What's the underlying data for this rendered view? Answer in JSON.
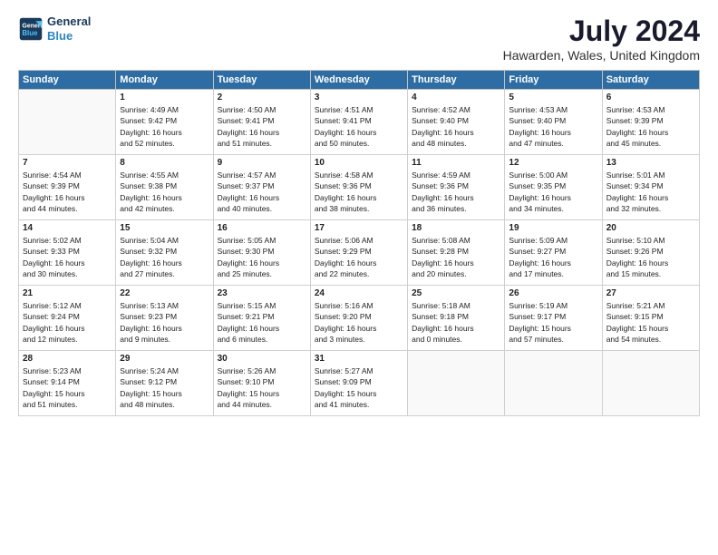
{
  "header": {
    "logo_line1": "General",
    "logo_line2": "Blue",
    "month": "July 2024",
    "location": "Hawarden, Wales, United Kingdom"
  },
  "weekdays": [
    "Sunday",
    "Monday",
    "Tuesday",
    "Wednesday",
    "Thursday",
    "Friday",
    "Saturday"
  ],
  "weeks": [
    [
      {
        "day": "",
        "info": ""
      },
      {
        "day": "1",
        "info": "Sunrise: 4:49 AM\nSunset: 9:42 PM\nDaylight: 16 hours\nand 52 minutes."
      },
      {
        "day": "2",
        "info": "Sunrise: 4:50 AM\nSunset: 9:41 PM\nDaylight: 16 hours\nand 51 minutes."
      },
      {
        "day": "3",
        "info": "Sunrise: 4:51 AM\nSunset: 9:41 PM\nDaylight: 16 hours\nand 50 minutes."
      },
      {
        "day": "4",
        "info": "Sunrise: 4:52 AM\nSunset: 9:40 PM\nDaylight: 16 hours\nand 48 minutes."
      },
      {
        "day": "5",
        "info": "Sunrise: 4:53 AM\nSunset: 9:40 PM\nDaylight: 16 hours\nand 47 minutes."
      },
      {
        "day": "6",
        "info": "Sunrise: 4:53 AM\nSunset: 9:39 PM\nDaylight: 16 hours\nand 45 minutes."
      }
    ],
    [
      {
        "day": "7",
        "info": "Sunrise: 4:54 AM\nSunset: 9:39 PM\nDaylight: 16 hours\nand 44 minutes."
      },
      {
        "day": "8",
        "info": "Sunrise: 4:55 AM\nSunset: 9:38 PM\nDaylight: 16 hours\nand 42 minutes."
      },
      {
        "day": "9",
        "info": "Sunrise: 4:57 AM\nSunset: 9:37 PM\nDaylight: 16 hours\nand 40 minutes."
      },
      {
        "day": "10",
        "info": "Sunrise: 4:58 AM\nSunset: 9:36 PM\nDaylight: 16 hours\nand 38 minutes."
      },
      {
        "day": "11",
        "info": "Sunrise: 4:59 AM\nSunset: 9:36 PM\nDaylight: 16 hours\nand 36 minutes."
      },
      {
        "day": "12",
        "info": "Sunrise: 5:00 AM\nSunset: 9:35 PM\nDaylight: 16 hours\nand 34 minutes."
      },
      {
        "day": "13",
        "info": "Sunrise: 5:01 AM\nSunset: 9:34 PM\nDaylight: 16 hours\nand 32 minutes."
      }
    ],
    [
      {
        "day": "14",
        "info": "Sunrise: 5:02 AM\nSunset: 9:33 PM\nDaylight: 16 hours\nand 30 minutes."
      },
      {
        "day": "15",
        "info": "Sunrise: 5:04 AM\nSunset: 9:32 PM\nDaylight: 16 hours\nand 27 minutes."
      },
      {
        "day": "16",
        "info": "Sunrise: 5:05 AM\nSunset: 9:30 PM\nDaylight: 16 hours\nand 25 minutes."
      },
      {
        "day": "17",
        "info": "Sunrise: 5:06 AM\nSunset: 9:29 PM\nDaylight: 16 hours\nand 22 minutes."
      },
      {
        "day": "18",
        "info": "Sunrise: 5:08 AM\nSunset: 9:28 PM\nDaylight: 16 hours\nand 20 minutes."
      },
      {
        "day": "19",
        "info": "Sunrise: 5:09 AM\nSunset: 9:27 PM\nDaylight: 16 hours\nand 17 minutes."
      },
      {
        "day": "20",
        "info": "Sunrise: 5:10 AM\nSunset: 9:26 PM\nDaylight: 16 hours\nand 15 minutes."
      }
    ],
    [
      {
        "day": "21",
        "info": "Sunrise: 5:12 AM\nSunset: 9:24 PM\nDaylight: 16 hours\nand 12 minutes."
      },
      {
        "day": "22",
        "info": "Sunrise: 5:13 AM\nSunset: 9:23 PM\nDaylight: 16 hours\nand 9 minutes."
      },
      {
        "day": "23",
        "info": "Sunrise: 5:15 AM\nSunset: 9:21 PM\nDaylight: 16 hours\nand 6 minutes."
      },
      {
        "day": "24",
        "info": "Sunrise: 5:16 AM\nSunset: 9:20 PM\nDaylight: 16 hours\nand 3 minutes."
      },
      {
        "day": "25",
        "info": "Sunrise: 5:18 AM\nSunset: 9:18 PM\nDaylight: 16 hours\nand 0 minutes."
      },
      {
        "day": "26",
        "info": "Sunrise: 5:19 AM\nSunset: 9:17 PM\nDaylight: 15 hours\nand 57 minutes."
      },
      {
        "day": "27",
        "info": "Sunrise: 5:21 AM\nSunset: 9:15 PM\nDaylight: 15 hours\nand 54 minutes."
      }
    ],
    [
      {
        "day": "28",
        "info": "Sunrise: 5:23 AM\nSunset: 9:14 PM\nDaylight: 15 hours\nand 51 minutes."
      },
      {
        "day": "29",
        "info": "Sunrise: 5:24 AM\nSunset: 9:12 PM\nDaylight: 15 hours\nand 48 minutes."
      },
      {
        "day": "30",
        "info": "Sunrise: 5:26 AM\nSunset: 9:10 PM\nDaylight: 15 hours\nand 44 minutes."
      },
      {
        "day": "31",
        "info": "Sunrise: 5:27 AM\nSunset: 9:09 PM\nDaylight: 15 hours\nand 41 minutes."
      },
      {
        "day": "",
        "info": ""
      },
      {
        "day": "",
        "info": ""
      },
      {
        "day": "",
        "info": ""
      }
    ]
  ]
}
